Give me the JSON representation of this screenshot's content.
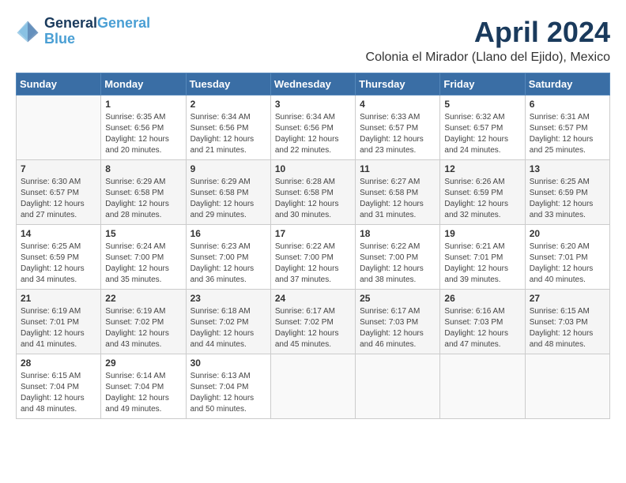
{
  "logo": {
    "line1": "General",
    "line2": "Blue"
  },
  "title": "April 2024",
  "location": "Colonia el Mirador (Llano del Ejido), Mexico",
  "headers": [
    "Sunday",
    "Monday",
    "Tuesday",
    "Wednesday",
    "Thursday",
    "Friday",
    "Saturday"
  ],
  "weeks": [
    [
      {
        "day": "",
        "sunrise": "",
        "sunset": "",
        "daylight": ""
      },
      {
        "day": "1",
        "sunrise": "Sunrise: 6:35 AM",
        "sunset": "Sunset: 6:56 PM",
        "daylight": "Daylight: 12 hours and 20 minutes."
      },
      {
        "day": "2",
        "sunrise": "Sunrise: 6:34 AM",
        "sunset": "Sunset: 6:56 PM",
        "daylight": "Daylight: 12 hours and 21 minutes."
      },
      {
        "day": "3",
        "sunrise": "Sunrise: 6:34 AM",
        "sunset": "Sunset: 6:56 PM",
        "daylight": "Daylight: 12 hours and 22 minutes."
      },
      {
        "day": "4",
        "sunrise": "Sunrise: 6:33 AM",
        "sunset": "Sunset: 6:57 PM",
        "daylight": "Daylight: 12 hours and 23 minutes."
      },
      {
        "day": "5",
        "sunrise": "Sunrise: 6:32 AM",
        "sunset": "Sunset: 6:57 PM",
        "daylight": "Daylight: 12 hours and 24 minutes."
      },
      {
        "day": "6",
        "sunrise": "Sunrise: 6:31 AM",
        "sunset": "Sunset: 6:57 PM",
        "daylight": "Daylight: 12 hours and 25 minutes."
      }
    ],
    [
      {
        "day": "7",
        "sunrise": "Sunrise: 6:30 AM",
        "sunset": "Sunset: 6:57 PM",
        "daylight": "Daylight: 12 hours and 27 minutes."
      },
      {
        "day": "8",
        "sunrise": "Sunrise: 6:29 AM",
        "sunset": "Sunset: 6:58 PM",
        "daylight": "Daylight: 12 hours and 28 minutes."
      },
      {
        "day": "9",
        "sunrise": "Sunrise: 6:29 AM",
        "sunset": "Sunset: 6:58 PM",
        "daylight": "Daylight: 12 hours and 29 minutes."
      },
      {
        "day": "10",
        "sunrise": "Sunrise: 6:28 AM",
        "sunset": "Sunset: 6:58 PM",
        "daylight": "Daylight: 12 hours and 30 minutes."
      },
      {
        "day": "11",
        "sunrise": "Sunrise: 6:27 AM",
        "sunset": "Sunset: 6:58 PM",
        "daylight": "Daylight: 12 hours and 31 minutes."
      },
      {
        "day": "12",
        "sunrise": "Sunrise: 6:26 AM",
        "sunset": "Sunset: 6:59 PM",
        "daylight": "Daylight: 12 hours and 32 minutes."
      },
      {
        "day": "13",
        "sunrise": "Sunrise: 6:25 AM",
        "sunset": "Sunset: 6:59 PM",
        "daylight": "Daylight: 12 hours and 33 minutes."
      }
    ],
    [
      {
        "day": "14",
        "sunrise": "Sunrise: 6:25 AM",
        "sunset": "Sunset: 6:59 PM",
        "daylight": "Daylight: 12 hours and 34 minutes."
      },
      {
        "day": "15",
        "sunrise": "Sunrise: 6:24 AM",
        "sunset": "Sunset: 7:00 PM",
        "daylight": "Daylight: 12 hours and 35 minutes."
      },
      {
        "day": "16",
        "sunrise": "Sunrise: 6:23 AM",
        "sunset": "Sunset: 7:00 PM",
        "daylight": "Daylight: 12 hours and 36 minutes."
      },
      {
        "day": "17",
        "sunrise": "Sunrise: 6:22 AM",
        "sunset": "Sunset: 7:00 PM",
        "daylight": "Daylight: 12 hours and 37 minutes."
      },
      {
        "day": "18",
        "sunrise": "Sunrise: 6:22 AM",
        "sunset": "Sunset: 7:00 PM",
        "daylight": "Daylight: 12 hours and 38 minutes."
      },
      {
        "day": "19",
        "sunrise": "Sunrise: 6:21 AM",
        "sunset": "Sunset: 7:01 PM",
        "daylight": "Daylight: 12 hours and 39 minutes."
      },
      {
        "day": "20",
        "sunrise": "Sunrise: 6:20 AM",
        "sunset": "Sunset: 7:01 PM",
        "daylight": "Daylight: 12 hours and 40 minutes."
      }
    ],
    [
      {
        "day": "21",
        "sunrise": "Sunrise: 6:19 AM",
        "sunset": "Sunset: 7:01 PM",
        "daylight": "Daylight: 12 hours and 41 minutes."
      },
      {
        "day": "22",
        "sunrise": "Sunrise: 6:19 AM",
        "sunset": "Sunset: 7:02 PM",
        "daylight": "Daylight: 12 hours and 43 minutes."
      },
      {
        "day": "23",
        "sunrise": "Sunrise: 6:18 AM",
        "sunset": "Sunset: 7:02 PM",
        "daylight": "Daylight: 12 hours and 44 minutes."
      },
      {
        "day": "24",
        "sunrise": "Sunrise: 6:17 AM",
        "sunset": "Sunset: 7:02 PM",
        "daylight": "Daylight: 12 hours and 45 minutes."
      },
      {
        "day": "25",
        "sunrise": "Sunrise: 6:17 AM",
        "sunset": "Sunset: 7:03 PM",
        "daylight": "Daylight: 12 hours and 46 minutes."
      },
      {
        "day": "26",
        "sunrise": "Sunrise: 6:16 AM",
        "sunset": "Sunset: 7:03 PM",
        "daylight": "Daylight: 12 hours and 47 minutes."
      },
      {
        "day": "27",
        "sunrise": "Sunrise: 6:15 AM",
        "sunset": "Sunset: 7:03 PM",
        "daylight": "Daylight: 12 hours and 48 minutes."
      }
    ],
    [
      {
        "day": "28",
        "sunrise": "Sunrise: 6:15 AM",
        "sunset": "Sunset: 7:04 PM",
        "daylight": "Daylight: 12 hours and 48 minutes."
      },
      {
        "day": "29",
        "sunrise": "Sunrise: 6:14 AM",
        "sunset": "Sunset: 7:04 PM",
        "daylight": "Daylight: 12 hours and 49 minutes."
      },
      {
        "day": "30",
        "sunrise": "Sunrise: 6:13 AM",
        "sunset": "Sunset: 7:04 PM",
        "daylight": "Daylight: 12 hours and 50 minutes."
      },
      {
        "day": "",
        "sunrise": "",
        "sunset": "",
        "daylight": ""
      },
      {
        "day": "",
        "sunrise": "",
        "sunset": "",
        "daylight": ""
      },
      {
        "day": "",
        "sunrise": "",
        "sunset": "",
        "daylight": ""
      },
      {
        "day": "",
        "sunrise": "",
        "sunset": "",
        "daylight": ""
      }
    ]
  ]
}
